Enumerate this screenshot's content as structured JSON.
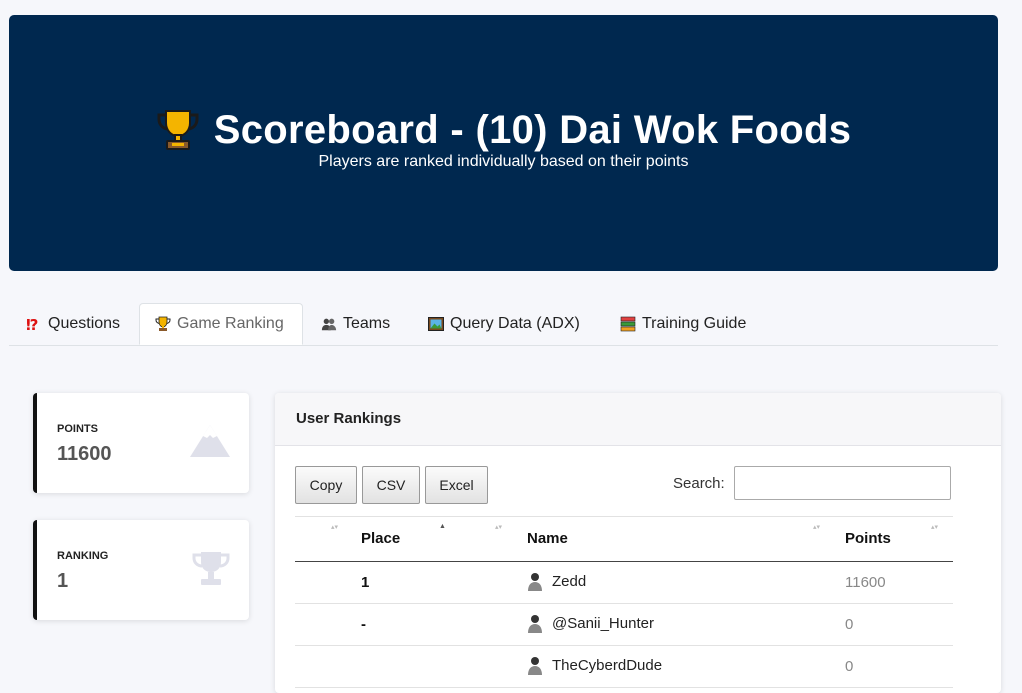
{
  "header": {
    "title": "Scoreboard - (10) Dai Wok Foods",
    "subtitle": "Players are ranked individually based on their points",
    "icon": "trophy-icon"
  },
  "tabs": [
    {
      "label": "Questions",
      "icon": "question-exclamation-icon",
      "active": false
    },
    {
      "label": "Game Ranking",
      "icon": "trophy-icon",
      "active": true
    },
    {
      "label": "Teams",
      "icon": "people-icon",
      "active": false
    },
    {
      "label": "Query Data (ADX)",
      "icon": "framed-picture-icon",
      "active": false
    },
    {
      "label": "Training Guide",
      "icon": "books-icon",
      "active": false
    }
  ],
  "stats": {
    "points": {
      "label": "POINTS",
      "value": "11600",
      "icon": "mountain-icon"
    },
    "ranking": {
      "label": "RANKING",
      "value": "1",
      "icon": "trophy-icon"
    }
  },
  "rankings": {
    "title": "User Rankings",
    "buttons": {
      "copy": "Copy",
      "csv": "CSV",
      "excel": "Excel"
    },
    "search_label": "Search:",
    "search_value": "",
    "columns": {
      "place": "Place",
      "name": "Name",
      "points": "Points"
    },
    "rows": [
      {
        "place": "1",
        "name": "Zedd",
        "points": "11600"
      },
      {
        "place": "-",
        "name": "@Sanii_Hunter",
        "points": "0"
      },
      {
        "place": "",
        "name": "TheCyberdDude",
        "points": "0"
      }
    ]
  },
  "colors": {
    "header_bg": "#00284f",
    "page_bg": "#f6f7fb",
    "accent_border": "#111111"
  }
}
